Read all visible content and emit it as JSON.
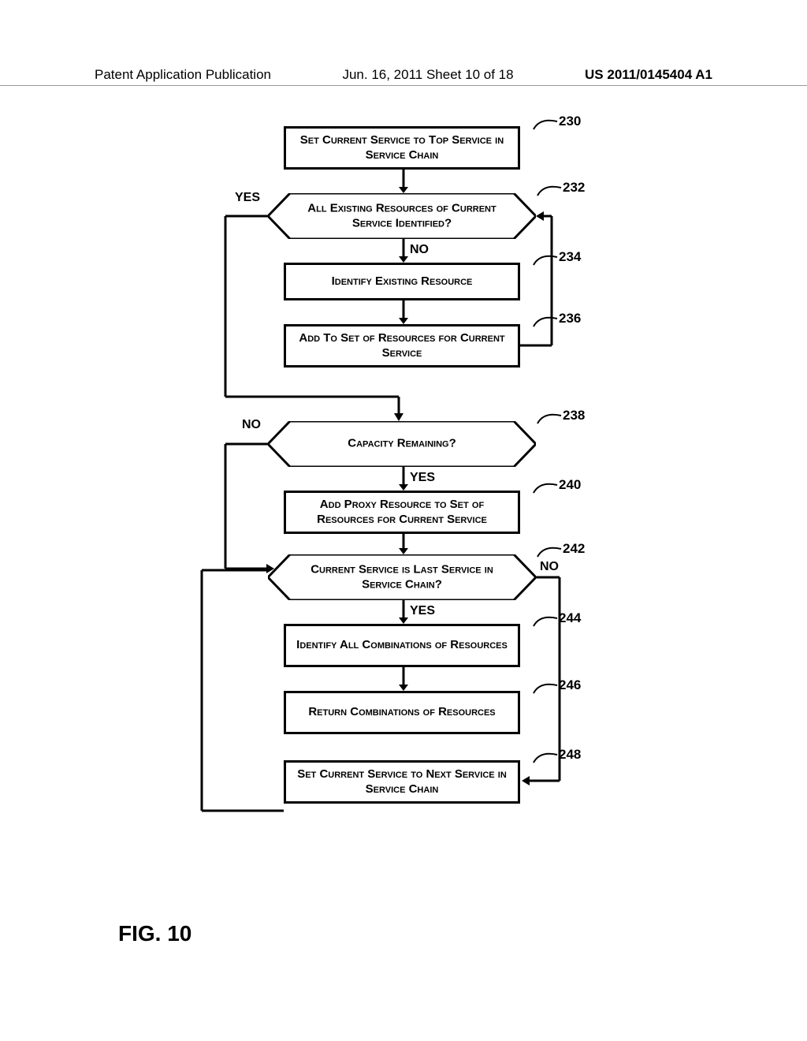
{
  "header": {
    "left": "Patent Application Publication",
    "mid": "Jun. 16, 2011  Sheet 10 of 18",
    "right": "US 2011/0145404 A1"
  },
  "figure_label": "FIG. 10",
  "refs": {
    "r230": "230",
    "r232": "232",
    "r234": "234",
    "r236": "236",
    "r238": "238",
    "r240": "240",
    "r242": "242",
    "r244": "244",
    "r246": "246",
    "r248": "248"
  },
  "labels": {
    "yes": "YES",
    "no": "NO"
  },
  "nodes": {
    "n230": "Set Current Service to Top Service in Service Chain",
    "n232": "All Existing Resources of Current Service Identified?",
    "n234": "Identify Existing Resource",
    "n236": "Add To Set of Resources for Current Service",
    "n238": "Capacity Remaining?",
    "n240": "Add Proxy Resource to Set of Resources for Current Service",
    "n242": "Current Service is Last Service in Service Chain?",
    "n244": "Identify All Combinations of Resources",
    "n246": "Return Combinations of Resources",
    "n248": "Set Current Service to Next Service in Service Chain"
  },
  "chart_data": {
    "type": "flowchart",
    "nodes": [
      {
        "id": 230,
        "shape": "process",
        "text": "Set Current Service to Top Service in Service Chain"
      },
      {
        "id": 232,
        "shape": "decision",
        "text": "All Existing Resources of Current Service Identified?"
      },
      {
        "id": 234,
        "shape": "process",
        "text": "Identify Existing Resource"
      },
      {
        "id": 236,
        "shape": "process",
        "text": "Add To Set of Resources for Current Service"
      },
      {
        "id": 238,
        "shape": "decision",
        "text": "Capacity Remaining?"
      },
      {
        "id": 240,
        "shape": "process",
        "text": "Add Proxy Resource to Set of Resources for Current Service"
      },
      {
        "id": 242,
        "shape": "decision",
        "text": "Current Service is Last Service in Service Chain?"
      },
      {
        "id": 244,
        "shape": "process",
        "text": "Identify All Combinations of Resources"
      },
      {
        "id": 246,
        "shape": "process",
        "text": "Return Combinations of Resources"
      },
      {
        "id": 248,
        "shape": "process",
        "text": "Set Current Service to Next Service in Service Chain"
      }
    ],
    "edges": [
      {
        "from": 230,
        "to": 232,
        "label": ""
      },
      {
        "from": 232,
        "to": 234,
        "label": "NO"
      },
      {
        "from": 234,
        "to": 236,
        "label": ""
      },
      {
        "from": 236,
        "to": 232,
        "label": ""
      },
      {
        "from": 232,
        "to": 238,
        "label": "YES"
      },
      {
        "from": 238,
        "to": 240,
        "label": "YES"
      },
      {
        "from": 238,
        "to": 242,
        "label": "NO"
      },
      {
        "from": 240,
        "to": 242,
        "label": ""
      },
      {
        "from": 242,
        "to": 244,
        "label": "YES"
      },
      {
        "from": 242,
        "to": 248,
        "label": "NO"
      },
      {
        "from": 244,
        "to": 246,
        "label": ""
      },
      {
        "from": 248,
        "to": 232,
        "label": ""
      }
    ]
  }
}
